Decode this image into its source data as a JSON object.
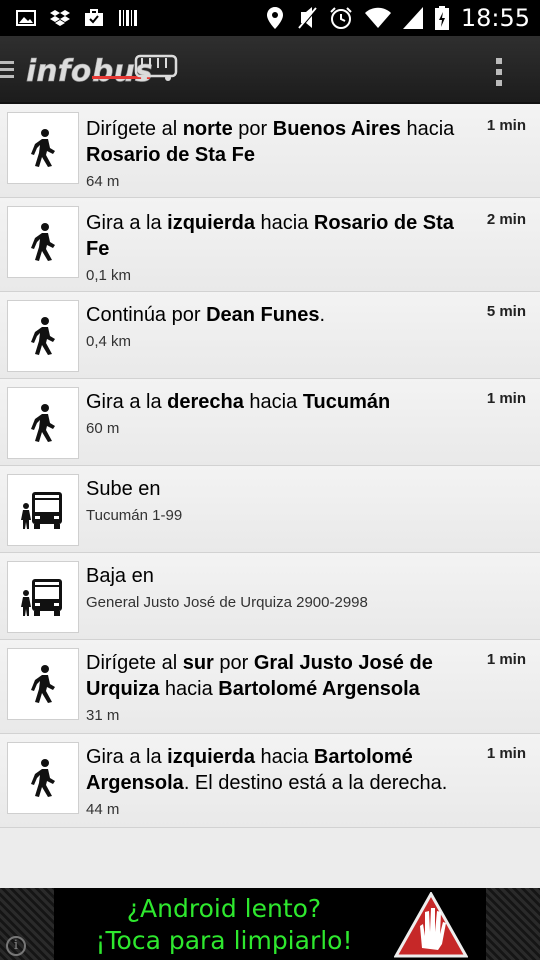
{
  "status_bar": {
    "time": "18:55",
    "left_icons": [
      "gallery-icon",
      "dropbox-icon",
      "briefcase-icon",
      "barcode-icon"
    ],
    "right_icons": [
      "location-icon",
      "mute-icon",
      "alarm-icon",
      "wifi-icon",
      "signal-icon",
      "battery-icon"
    ]
  },
  "app": {
    "name": "infobus",
    "logo_colors": {
      "text": "#e8e8e8",
      "accent": "#e53935"
    }
  },
  "steps": [
    {
      "icon": "walk-icon",
      "parts": [
        {
          "t": "Dirígete al ",
          "b": false
        },
        {
          "t": "norte",
          "b": true
        },
        {
          "t": " por ",
          "b": false
        },
        {
          "t": "Buenos Aires",
          "b": true
        },
        {
          "t": " hacia ",
          "b": false
        },
        {
          "t": "Rosario de Sta Fe",
          "b": true
        }
      ],
      "distance": "64 m",
      "time": "1 min"
    },
    {
      "icon": "walk-icon",
      "parts": [
        {
          "t": "Gira a la ",
          "b": false
        },
        {
          "t": "izquierda",
          "b": true
        },
        {
          "t": " hacia ",
          "b": false
        },
        {
          "t": "Rosario de Sta Fe",
          "b": true
        }
      ],
      "distance": "0,1 km",
      "time": "2 min"
    },
    {
      "icon": "walk-icon",
      "parts": [
        {
          "t": "Continúa por ",
          "b": false
        },
        {
          "t": "Dean Funes",
          "b": true
        },
        {
          "t": ".",
          "b": false
        }
      ],
      "distance": "0,4 km",
      "time": "5 min"
    },
    {
      "icon": "walk-icon",
      "parts": [
        {
          "t": "Gira a la ",
          "b": false
        },
        {
          "t": "derecha",
          "b": true
        },
        {
          "t": " hacia ",
          "b": false
        },
        {
          "t": "Tucumán",
          "b": true
        }
      ],
      "distance": "60 m",
      "time": "1 min"
    },
    {
      "icon": "bus-icon",
      "parts": [
        {
          "t": "Sube en",
          "b": false
        }
      ],
      "distance": "Tucumán 1-99",
      "time": ""
    },
    {
      "icon": "bus-icon",
      "parts": [
        {
          "t": "Baja en",
          "b": false
        }
      ],
      "distance": "General Justo José de Urquiza 2900-2998",
      "time": ""
    },
    {
      "icon": "walk-icon",
      "parts": [
        {
          "t": "Dirígete al ",
          "b": false
        },
        {
          "t": "sur",
          "b": true
        },
        {
          "t": " por ",
          "b": false
        },
        {
          "t": "Gral Justo José de Urquiza",
          "b": true
        },
        {
          "t": " hacia ",
          "b": false
        },
        {
          "t": "Bartolomé Argensola",
          "b": true
        }
      ],
      "distance": "31 m",
      "time": "1 min"
    },
    {
      "icon": "walk-icon",
      "parts": [
        {
          "t": "Gira a la ",
          "b": false
        },
        {
          "t": "izquierda",
          "b": true
        },
        {
          "t": " hacia ",
          "b": false
        },
        {
          "t": "Bartolomé Argensola",
          "b": true
        },
        {
          "t": ". El destino está a la derecha.",
          "b": false
        }
      ],
      "distance": "44 m",
      "time": "1 min"
    }
  ],
  "ad": {
    "line1": "¿Android lento?",
    "line2": "¡Toca para limpiarlo!",
    "info_glyph": "i",
    "text_color": "#2ee82e"
  }
}
